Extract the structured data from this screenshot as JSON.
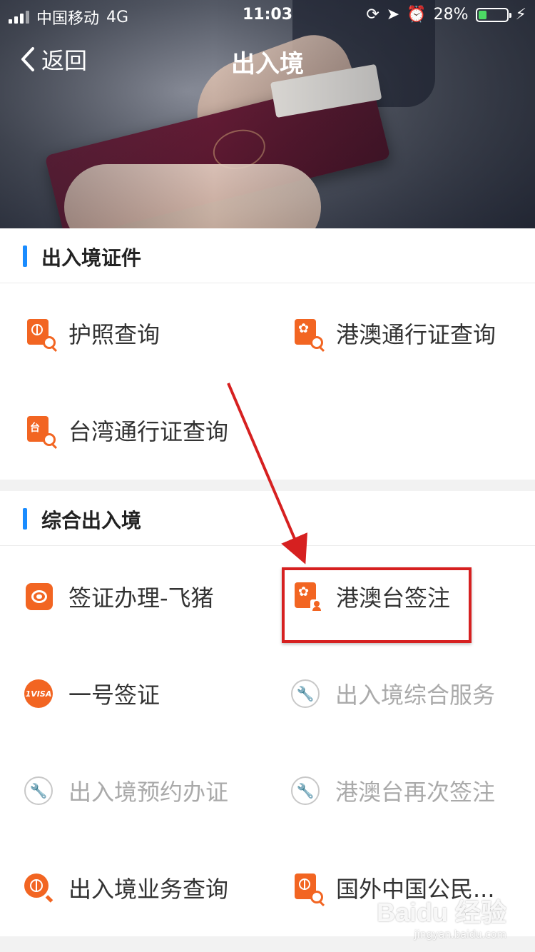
{
  "status": {
    "carrier": "中国移动",
    "network": "4G",
    "time": "11:03",
    "battery": "28%",
    "battery_level": 0.28
  },
  "nav": {
    "back_label": "返回",
    "title": "出入境"
  },
  "section1": {
    "title": "出入境证件",
    "items": [
      {
        "label": "护照查询",
        "icon": "passport-search-icon"
      },
      {
        "label": "港澳通行证查询",
        "icon": "hk-macau-permit-search-icon"
      },
      {
        "label": "台湾通行证查询",
        "icon": "taiwan-permit-search-icon"
      }
    ]
  },
  "section2": {
    "title": "综合出入境",
    "items": [
      {
        "label": "签证办理-飞猪",
        "icon": "fliggy-pig-icon"
      },
      {
        "label": "港澳台签注",
        "icon": "endorsement-person-icon"
      },
      {
        "label": "一号签证",
        "icon": "1visa-icon",
        "icon_text": "1VISA"
      },
      {
        "label": "出入境综合服务",
        "icon": "wrench-icon",
        "disabled": true
      },
      {
        "label": "出入境预约办证",
        "icon": "wrench-icon",
        "disabled": true
      },
      {
        "label": "港澳台再次签注",
        "icon": "wrench-icon",
        "disabled": true
      },
      {
        "label": "出入境业务查询",
        "icon": "globe-search-icon"
      },
      {
        "label": "国外中国公民...",
        "icon": "globe-document-icon"
      }
    ]
  },
  "watermark": {
    "brand": "Baidu 经验",
    "url": "jingyan.baidu.com"
  },
  "colors": {
    "accent": "#1a8cff",
    "icon_orange": "#f26522",
    "annotation_red": "#d62020",
    "disabled_text": "#aaaaaa"
  }
}
